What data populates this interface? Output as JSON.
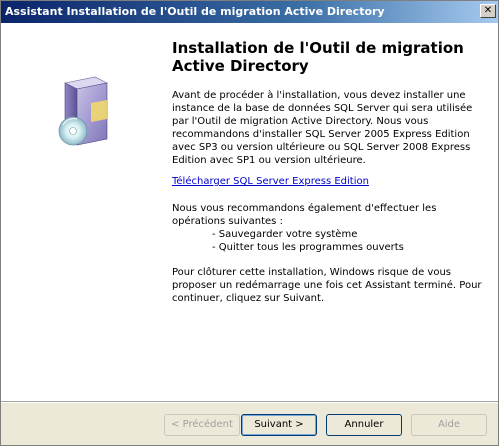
{
  "window": {
    "title": "Assistant Installation de l'Outil de migration Active Directory",
    "close_glyph": "✕"
  },
  "content": {
    "heading": "Installation de l'Outil de migration Active Directory",
    "intro": "Avant de procéder à l'installation, vous devez installer une instance de la base de données SQL Server qui sera utilisée par l'Outil de migration Active Directory. Nous vous recommandons d'installer SQL Server 2005 Express Edition avec SP3 ou version ultérieure ou SQL Server 2008 Express Edition avec SP1 ou version ultérieure.",
    "link": "Télécharger SQL Server Express Edition",
    "recommend": "Nous vous recommandons également d'effectuer les opérations suivantes :",
    "ops": [
      "- Sauvegarder votre système",
      "- Quitter tous les programmes ouverts"
    ],
    "closing": "Pour clôturer cette installation, Windows risque de vous proposer un redémarrage une fois cet Assistant terminé. Pour continuer, cliquez sur Suivant."
  },
  "buttons": {
    "back": "< Précédent",
    "next": "Suivant >",
    "cancel": "Annuler",
    "help": "Aide"
  },
  "icon": "software-box-cd-icon"
}
